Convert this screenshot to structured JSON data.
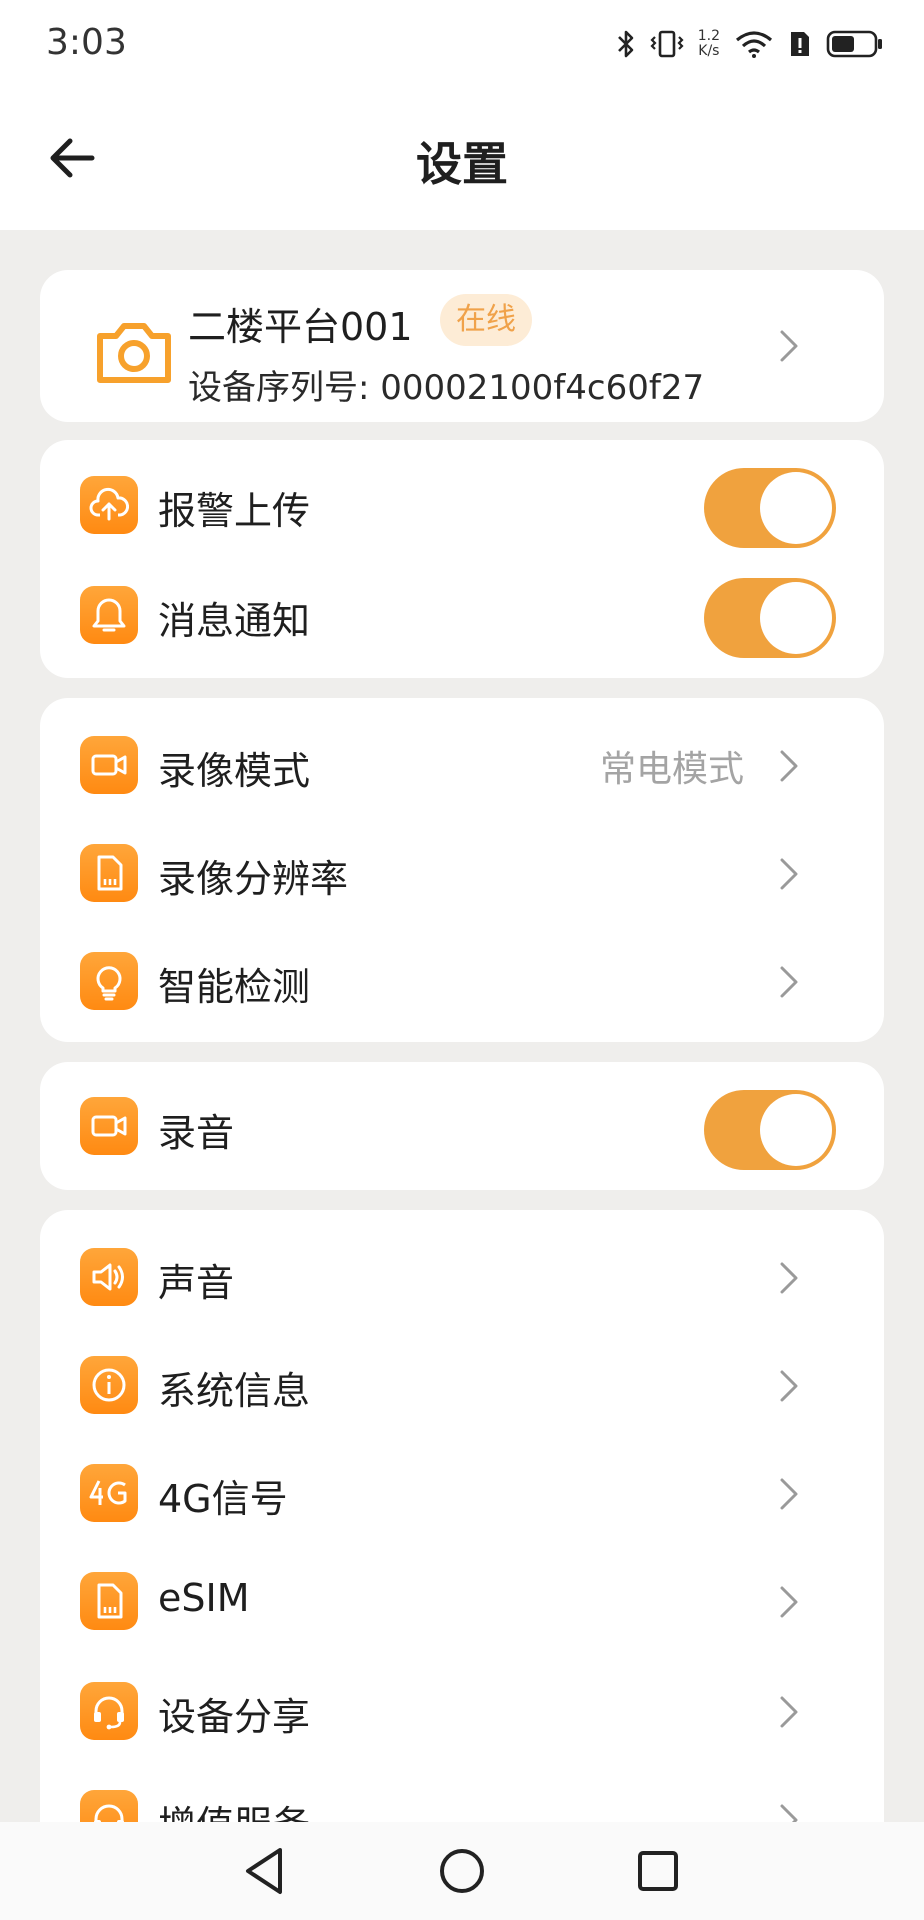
{
  "status_bar": {
    "time": "3:03",
    "net_speed_value": "1.2",
    "net_speed_unit": "K/s"
  },
  "header": {
    "title": "设置"
  },
  "device": {
    "name": "二楼平台001",
    "status": "在线",
    "serial": "设备序列号: 00002100f4c60f27"
  },
  "group1": [
    {
      "label": "报警上传",
      "icon": "cloud-upload-icon",
      "toggle_on": true
    },
    {
      "label": "消息通知",
      "icon": "bell-icon",
      "toggle_on": true
    }
  ],
  "group2": [
    {
      "label": "录像模式",
      "value": "常电模式",
      "icon": "video-camera-icon"
    },
    {
      "label": "录像分辨率",
      "icon": "sd-card-icon"
    },
    {
      "label": "智能检测",
      "icon": "lightbulb-icon"
    }
  ],
  "group3": [
    {
      "label": "录音",
      "icon": "video-camera-icon",
      "toggle_on": true
    }
  ],
  "group4": [
    {
      "label": "声音",
      "icon": "speaker-icon"
    },
    {
      "label": "系统信息",
      "icon": "info-icon"
    },
    {
      "label": "4G信号",
      "icon": "4g-icon"
    },
    {
      "label": "eSIM",
      "icon": "sim-card-icon"
    },
    {
      "label": "设备分享",
      "icon": "headset-icon"
    },
    {
      "label": "增值服务",
      "icon": "headset-icon"
    }
  ],
  "colors": {
    "accent": "#f0a23e",
    "icon_gradient_top": "#ffa63a",
    "icon_gradient_bottom": "#ff8a12",
    "badge_bg": "#fdecd6",
    "page_bg": "#efeeec"
  }
}
